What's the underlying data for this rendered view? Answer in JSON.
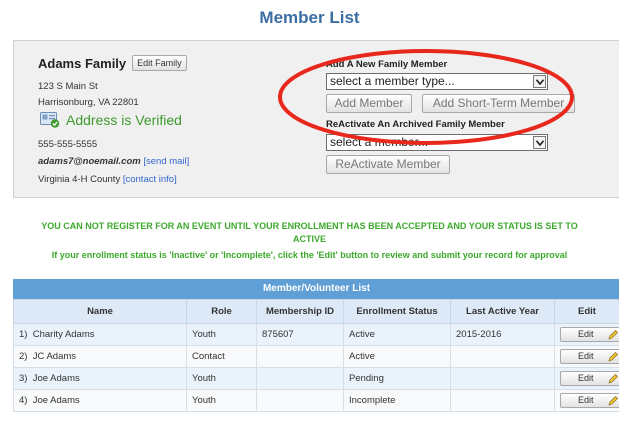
{
  "page": {
    "title": "Member List"
  },
  "family": {
    "name": "Adams Family",
    "edit_label": "Edit Family",
    "address1": "123 S Main St",
    "address2": "Harrisonburg, VA 22801",
    "verified_text": "Address is Verified",
    "phone": "555-555-5555",
    "email": "adams7@noemail.com",
    "send_mail": "[send mail]",
    "county": "Virginia 4-H County",
    "contact_info": "[contact info]"
  },
  "add_member": {
    "label": "Add A New Family Member",
    "select_value": "select a member type...",
    "add_button": "Add Member",
    "add_short_term_button": "Add Short-Term Member"
  },
  "reactivate": {
    "label": "ReActivate An Archived Family Member",
    "select_value": "select a member...",
    "button": "ReActivate Member"
  },
  "warnings": {
    "line1a": "YOU CAN NOT REGISTER FOR AN EVENT UNTIL YOUR ENROLLMENT HAS BEEN ACCEPTED AND YOUR STATUS IS SET TO",
    "line1b": "ACTIVE",
    "line2": "If your enrollment status is 'Inactive' or 'Incomplete', click the 'Edit' button to review and submit your record for approval"
  },
  "table": {
    "title": "Member/Volunteer List",
    "headers": [
      "Name",
      "Role",
      "Membership ID",
      "Enrollment Status",
      "Last Active Year",
      "Edit"
    ],
    "rows": [
      {
        "num": "1)",
        "name": "Charity Adams",
        "role": "Youth",
        "id": "875607",
        "status": "Active",
        "year": "2015-2016",
        "edit": "Edit"
      },
      {
        "num": "2)",
        "name": "JC Adams",
        "role": "Contact",
        "id": "",
        "status": "Active",
        "year": "",
        "edit": "Edit"
      },
      {
        "num": "3)",
        "name": "Joe Adams",
        "role": "Youth",
        "id": "",
        "status": "Pending",
        "year": "",
        "edit": "Edit"
      },
      {
        "num": "4)",
        "name": "Joe Adams",
        "role": "Youth",
        "id": "",
        "status": "Incomplete",
        "year": "",
        "edit": "Edit"
      }
    ]
  },
  "colors": {
    "title_blue": "#3a6ea5",
    "verified_green": "#3c9a2c",
    "warning_green": "#3ca92c",
    "table_header_blue": "#5f9fd6",
    "highlight_red": "#e8281c",
    "link_blue": "#3366cc"
  },
  "icons": {
    "verified": "address-card-check-icon",
    "dropdown": "chevron-down-icon",
    "edit": "pencil-icon"
  }
}
